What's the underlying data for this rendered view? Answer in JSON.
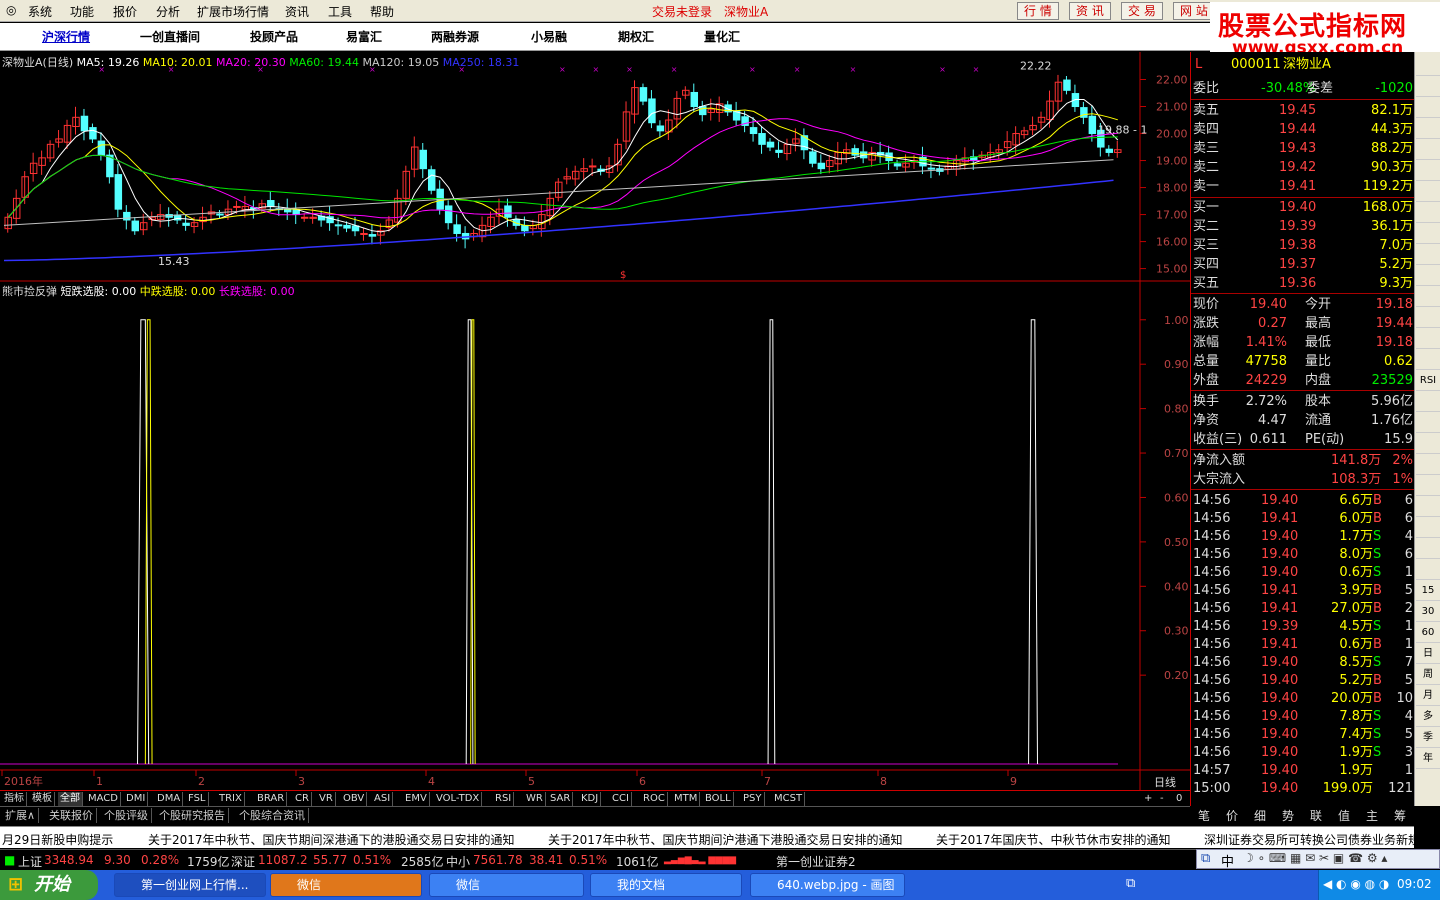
{
  "menu": {
    "items": [
      "系统",
      "功能",
      "报价",
      "分析",
      "扩展市场行情",
      "资讯",
      "工具",
      "帮助"
    ],
    "status_login": "交易未登录",
    "status_stock": "深物业A",
    "right_buttons": [
      "行 情",
      "资 讯",
      "交 易",
      "网 站"
    ]
  },
  "logo": {
    "title": "股票公式指标网",
    "url": "www.gsxx.com.cn"
  },
  "nav": {
    "items": [
      "沪深行情",
      "一创直播间",
      "投顾产品",
      "易富汇",
      "两融券源",
      "小易融",
      "期权汇",
      "量化汇"
    ]
  },
  "price_legend": {
    "name": "深物业A(日线)",
    "ma5": "MA5: 19.26",
    "ma10": "MA10: 20.01",
    "ma20": "MA20: 20.30",
    "ma60": "MA60: 19.44",
    "ma120": "MA120: 19.05",
    "ma250": "MA250: 18.31"
  },
  "indicator_legend": {
    "name": "熊市捡反弹",
    "short": "短跌选股: 0.00",
    "mid": "中跌选股: 0.00",
    "long": "长跌选股: 0.00"
  },
  "price_annotations": {
    "high": "22.22",
    "low": "15.43",
    "last": "19.88 - 1"
  },
  "colors": {
    "up": "#ff3232",
    "down": "#54ffff",
    "ma5": "#ffffff",
    "ma10": "#ffff00",
    "ma20": "#ff00ff",
    "ma60": "#00e600",
    "ma120": "#c0c0c0",
    "ma250": "#3232ff",
    "frame": "#c00000"
  },
  "chart_data": [
    {
      "type": "candlestick",
      "title": "深物业A(日线)",
      "x_labels": [
        "2016年",
        "1",
        "2",
        "3",
        "4",
        "5",
        "6",
        "7",
        "8",
        "9"
      ],
      "y_ticks": [
        "22.00",
        "21.00",
        "20.00",
        "19.00",
        "18.00",
        "17.00",
        "16.00",
        "15.00"
      ],
      "ylim": [
        14.8,
        22.5
      ],
      "close": [
        16.9,
        17.6,
        18.4,
        18.9,
        19.1,
        19.6,
        19.8,
        20.3,
        20.6,
        20.1,
        19.8,
        19.2,
        18.4,
        17.2,
        16.8,
        16.4,
        16.7,
        16.9,
        17.0,
        16.9,
        16.8,
        16.6,
        16.7,
        16.9,
        17.1,
        17.0,
        17.2,
        17.3,
        17.3,
        17.2,
        17.4,
        17.3,
        17.2,
        17.1,
        17.0,
        16.9,
        16.9,
        16.8,
        16.7,
        16.6,
        16.5,
        16.4,
        16.3,
        16.2,
        16.4,
        16.8,
        17.6,
        18.6,
        19.5,
        18.7,
        17.9,
        17.2,
        16.7,
        16.3,
        16.1,
        16.3,
        16.6,
        16.9,
        17.2,
        16.9,
        16.6,
        16.4,
        16.6,
        17.0,
        17.6,
        18.2,
        18.4,
        18.6,
        18.7,
        18.8,
        18.6,
        18.8,
        19.6,
        20.8,
        21.7,
        21.2,
        20.4,
        20.1,
        20.5,
        21.3,
        21.6,
        21.0,
        20.7,
        20.9,
        21.1,
        20.8,
        20.5,
        20.3,
        20.0,
        19.6,
        19.5,
        19.3,
        19.6,
        19.8,
        19.4,
        18.9,
        18.7,
        19.0,
        19.3,
        19.4,
        19.2,
        19.1,
        19.3,
        19.2,
        19.0,
        18.8,
        18.9,
        19.0,
        18.8,
        18.7,
        18.6,
        18.8,
        19.0,
        19.1,
        19.0,
        19.2,
        19.3,
        19.4,
        19.7,
        20.0,
        20.1,
        20.3,
        20.6,
        21.2,
        21.9,
        21.6,
        21.0,
        20.6,
        20.0,
        19.5,
        19.3,
        19.4
      ],
      "ma_values": {
        "MA5": 19.26,
        "MA10": 20.01,
        "MA20": 20.3,
        "MA60": 19.44,
        "MA120": 19.05,
        "MA250": 18.31
      },
      "annotations": {
        "high": 22.22,
        "low": 15.43
      }
    },
    {
      "type": "line",
      "title": "熊市捡反弹",
      "y_ticks": [
        "1.00",
        "0.90",
        "0.80",
        "0.70",
        "0.60",
        "0.50",
        "0.40",
        "0.30",
        "0.20"
      ],
      "ylim": [
        0,
        1.04
      ],
      "series": [
        {
          "name": "短跌选股",
          "signals": [
            {
              "x": 0.123,
              "w": 0.01
            },
            {
              "x": 0.417,
              "w": 0.006
            },
            {
              "x": 0.687,
              "w": 0.006
            },
            {
              "x": 0.92,
              "w": 0.008
            }
          ],
          "value": 1.0
        },
        {
          "name": "中跌选股",
          "signals": [
            {
              "x": 0.13,
              "w": 0.006
            },
            {
              "x": 0.421,
              "w": 0.004
            }
          ],
          "value": 1.0
        },
        {
          "name": "长跌选股",
          "signals": [],
          "value": 0.0
        }
      ]
    }
  ],
  "quote": {
    "code_row": {
      "flag": "L",
      "code": "000011",
      "name": "深物业A"
    },
    "webi": {
      "label": "委比",
      "value": "-30.48%",
      "label2": "委差",
      "value2": "-1020"
    },
    "asks": [
      {
        "label": "卖五",
        "price": "19.45",
        "vol": "82.1万"
      },
      {
        "label": "卖四",
        "price": "19.44",
        "vol": "44.3万"
      },
      {
        "label": "卖三",
        "price": "19.43",
        "vol": "88.2万"
      },
      {
        "label": "卖二",
        "price": "19.42",
        "vol": "90.3万"
      },
      {
        "label": "卖一",
        "price": "19.41",
        "vol": "119.2万"
      }
    ],
    "bids": [
      {
        "label": "买一",
        "price": "19.40",
        "vol": "168.0万"
      },
      {
        "label": "买二",
        "price": "19.39",
        "vol": "36.1万"
      },
      {
        "label": "买三",
        "price": "19.38",
        "vol": "7.0万"
      },
      {
        "label": "买四",
        "price": "19.37",
        "vol": "5.2万"
      },
      {
        "label": "买五",
        "price": "19.36",
        "vol": "9.3万"
      }
    ],
    "stats": [
      {
        "l1": "现价",
        "v1": "19.40",
        "l2": "今开",
        "v2": "19.18"
      },
      {
        "l1": "涨跌",
        "v1": "0.27",
        "l2": "最高",
        "v2": "19.44"
      },
      {
        "l1": "涨幅",
        "v1": "1.41%",
        "l2": "最低",
        "v2": "19.18"
      },
      {
        "l1": "总量",
        "v1": "47758",
        "l2": "量比",
        "v2": "0.62"
      },
      {
        "l1": "外盘",
        "v1": "24229",
        "l2": "内盘",
        "v2": "23529"
      }
    ],
    "stats2": [
      {
        "l1": "换手",
        "v1": "2.72%",
        "l2": "股本",
        "v2": "5.96亿"
      },
      {
        "l1": "净资",
        "v1": "4.47",
        "l2": "流通",
        "v2": "1.76亿"
      },
      {
        "l1": "收益(三)",
        "v1": "0.611",
        "l2": "PE(动)",
        "v2": "15.9"
      }
    ],
    "flows": [
      {
        "label": "净流入额",
        "value": "141.8万",
        "pct": "2%"
      },
      {
        "label": "大宗流入",
        "value": "108.3万",
        "pct": "1%"
      }
    ],
    "ticks": [
      {
        "t": "14:56",
        "p": "19.40",
        "v": "6.6万",
        "s": "B",
        "n": "6"
      },
      {
        "t": "14:56",
        "p": "19.41",
        "v": "6.0万",
        "s": "B",
        "n": "6"
      },
      {
        "t": "14:56",
        "p": "19.40",
        "v": "1.7万",
        "s": "S",
        "n": "4"
      },
      {
        "t": "14:56",
        "p": "19.40",
        "v": "8.0万",
        "s": "S",
        "n": "6"
      },
      {
        "t": "14:56",
        "p": "19.40",
        "v": "0.6万",
        "s": "S",
        "n": "1"
      },
      {
        "t": "14:56",
        "p": "19.41",
        "v": "3.9万",
        "s": "B",
        "n": "5"
      },
      {
        "t": "14:56",
        "p": "19.41",
        "v": "27.0万",
        "s": "B",
        "n": "2"
      },
      {
        "t": "14:56",
        "p": "19.39",
        "v": "4.5万",
        "s": "S",
        "n": "1"
      },
      {
        "t": "14:56",
        "p": "19.41",
        "v": "0.6万",
        "s": "B",
        "n": "1"
      },
      {
        "t": "14:56",
        "p": "19.40",
        "v": "8.5万",
        "s": "S",
        "n": "7"
      },
      {
        "t": "14:56",
        "p": "19.40",
        "v": "5.2万",
        "s": "B",
        "n": "5"
      },
      {
        "t": "14:56",
        "p": "19.40",
        "v": "20.0万",
        "s": "B",
        "n": "10"
      },
      {
        "t": "14:56",
        "p": "19.40",
        "v": "7.8万",
        "s": "S",
        "n": "4"
      },
      {
        "t": "14:56",
        "p": "19.40",
        "v": "7.4万",
        "s": "S",
        "n": "5"
      },
      {
        "t": "14:56",
        "p": "19.40",
        "v": "1.9万",
        "s": "S",
        "n": "3"
      },
      {
        "t": "14:57",
        "p": "19.40",
        "v": "1.9万",
        "s": "",
        "n": "1"
      },
      {
        "t": "15:00",
        "p": "19.40",
        "v": "199.0万",
        "s": "",
        "n": "121"
      }
    ]
  },
  "side_tabs": [
    "",
    "",
    "",
    "",
    "",
    "",
    "",
    "",
    "",
    "",
    "",
    "",
    "",
    "",
    "",
    "RSI",
    "",
    "",
    "",
    "",
    "",
    "",
    "",
    "",
    "",
    "15",
    "30",
    "60",
    "日",
    "周",
    "月",
    "多",
    "季",
    "年"
  ],
  "index_tabs": [
    "指标",
    "模板",
    "全部",
    "MACD",
    "DMI",
    "DMA",
    "FSL",
    "TRIX",
    "BRAR",
    "CR",
    "VR",
    "OBV",
    "ASI",
    "EMV",
    "VOL-TDX",
    "RSI",
    "WR",
    "SAR",
    "KDJ",
    "CCI",
    "ROC",
    "MTM",
    "BOLL",
    "PSY",
    "MCST"
  ],
  "index_tabs_right": [
    "+",
    "-",
    "0"
  ],
  "ext_tabs": [
    "扩展∧",
    "关联报价",
    "个股评级",
    "个股研究报告",
    "个股综合资讯"
  ],
  "quote_tabs": [
    "笔",
    "价",
    "细",
    "势",
    "联",
    "值",
    "主",
    "筹"
  ],
  "period_label": "日线",
  "news": [
    "月29日新股申购提示",
    "关于2017年中秋节、国庆节期间深港通下的港股通交易日安排的通知",
    "关于2017年中秋节、国庆节期间沪港通下港股通交易日安排的通知",
    "关于2017年国庆节、中秋节休市安排的通知",
    "深圳证券交易所可转换公司债券业务新规"
  ],
  "ticker": {
    "sh_label": "上证",
    "sh_val": "3348.94",
    "sh_chg": "9.30",
    "sh_pct": "0.28%",
    "sh_amt": "1759亿",
    "sz_label": "深证",
    "sz_val": "11087.2",
    "sz_chg": "55.77",
    "sz_pct": "0.51%",
    "sz_amt": "2585亿",
    "zx_label": "中小",
    "zx_val": "7561.78",
    "zx_chg": "38.41",
    "zx_pct": "0.51%",
    "zx_amt": "1061亿",
    "broker": "第一创业证券2"
  },
  "ime": {
    "mode": "中"
  },
  "taskbar": {
    "start": "开始",
    "tasks": [
      "第一创业网上行情...",
      "微信",
      "微信",
      "我的文档",
      "640.webp.jpg - 画图"
    ],
    "clock": "09:02"
  }
}
